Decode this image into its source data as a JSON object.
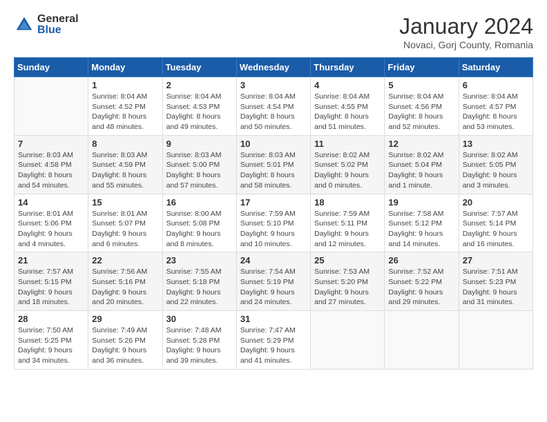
{
  "logo": {
    "general": "General",
    "blue": "Blue"
  },
  "header": {
    "title": "January 2024",
    "location": "Novaci, Gorj County, Romania"
  },
  "weekdays": [
    "Sunday",
    "Monday",
    "Tuesday",
    "Wednesday",
    "Thursday",
    "Friday",
    "Saturday"
  ],
  "weeks": [
    [
      {
        "day": "",
        "sunrise": "",
        "sunset": "",
        "daylight": ""
      },
      {
        "day": "1",
        "sunrise": "Sunrise: 8:04 AM",
        "sunset": "Sunset: 4:52 PM",
        "daylight": "Daylight: 8 hours and 48 minutes."
      },
      {
        "day": "2",
        "sunrise": "Sunrise: 8:04 AM",
        "sunset": "Sunset: 4:53 PM",
        "daylight": "Daylight: 8 hours and 49 minutes."
      },
      {
        "day": "3",
        "sunrise": "Sunrise: 8:04 AM",
        "sunset": "Sunset: 4:54 PM",
        "daylight": "Daylight: 8 hours and 50 minutes."
      },
      {
        "day": "4",
        "sunrise": "Sunrise: 8:04 AM",
        "sunset": "Sunset: 4:55 PM",
        "daylight": "Daylight: 8 hours and 51 minutes."
      },
      {
        "day": "5",
        "sunrise": "Sunrise: 8:04 AM",
        "sunset": "Sunset: 4:56 PM",
        "daylight": "Daylight: 8 hours and 52 minutes."
      },
      {
        "day": "6",
        "sunrise": "Sunrise: 8:04 AM",
        "sunset": "Sunset: 4:57 PM",
        "daylight": "Daylight: 8 hours and 53 minutes."
      }
    ],
    [
      {
        "day": "7",
        "sunrise": "Sunrise: 8:03 AM",
        "sunset": "Sunset: 4:58 PM",
        "daylight": "Daylight: 8 hours and 54 minutes."
      },
      {
        "day": "8",
        "sunrise": "Sunrise: 8:03 AM",
        "sunset": "Sunset: 4:59 PM",
        "daylight": "Daylight: 8 hours and 55 minutes."
      },
      {
        "day": "9",
        "sunrise": "Sunrise: 8:03 AM",
        "sunset": "Sunset: 5:00 PM",
        "daylight": "Daylight: 8 hours and 57 minutes."
      },
      {
        "day": "10",
        "sunrise": "Sunrise: 8:03 AM",
        "sunset": "Sunset: 5:01 PM",
        "daylight": "Daylight: 8 hours and 58 minutes."
      },
      {
        "day": "11",
        "sunrise": "Sunrise: 8:02 AM",
        "sunset": "Sunset: 5:02 PM",
        "daylight": "Daylight: 9 hours and 0 minutes."
      },
      {
        "day": "12",
        "sunrise": "Sunrise: 8:02 AM",
        "sunset": "Sunset: 5:04 PM",
        "daylight": "Daylight: 9 hours and 1 minute."
      },
      {
        "day": "13",
        "sunrise": "Sunrise: 8:02 AM",
        "sunset": "Sunset: 5:05 PM",
        "daylight": "Daylight: 9 hours and 3 minutes."
      }
    ],
    [
      {
        "day": "14",
        "sunrise": "Sunrise: 8:01 AM",
        "sunset": "Sunset: 5:06 PM",
        "daylight": "Daylight: 9 hours and 4 minutes."
      },
      {
        "day": "15",
        "sunrise": "Sunrise: 8:01 AM",
        "sunset": "Sunset: 5:07 PM",
        "daylight": "Daylight: 9 hours and 6 minutes."
      },
      {
        "day": "16",
        "sunrise": "Sunrise: 8:00 AM",
        "sunset": "Sunset: 5:08 PM",
        "daylight": "Daylight: 9 hours and 8 minutes."
      },
      {
        "day": "17",
        "sunrise": "Sunrise: 7:59 AM",
        "sunset": "Sunset: 5:10 PM",
        "daylight": "Daylight: 9 hours and 10 minutes."
      },
      {
        "day": "18",
        "sunrise": "Sunrise: 7:59 AM",
        "sunset": "Sunset: 5:11 PM",
        "daylight": "Daylight: 9 hours and 12 minutes."
      },
      {
        "day": "19",
        "sunrise": "Sunrise: 7:58 AM",
        "sunset": "Sunset: 5:12 PM",
        "daylight": "Daylight: 9 hours and 14 minutes."
      },
      {
        "day": "20",
        "sunrise": "Sunrise: 7:57 AM",
        "sunset": "Sunset: 5:14 PM",
        "daylight": "Daylight: 9 hours and 16 minutes."
      }
    ],
    [
      {
        "day": "21",
        "sunrise": "Sunrise: 7:57 AM",
        "sunset": "Sunset: 5:15 PM",
        "daylight": "Daylight: 9 hours and 18 minutes."
      },
      {
        "day": "22",
        "sunrise": "Sunrise: 7:56 AM",
        "sunset": "Sunset: 5:16 PM",
        "daylight": "Daylight: 9 hours and 20 minutes."
      },
      {
        "day": "23",
        "sunrise": "Sunrise: 7:55 AM",
        "sunset": "Sunset: 5:18 PM",
        "daylight": "Daylight: 9 hours and 22 minutes."
      },
      {
        "day": "24",
        "sunrise": "Sunrise: 7:54 AM",
        "sunset": "Sunset: 5:19 PM",
        "daylight": "Daylight: 9 hours and 24 minutes."
      },
      {
        "day": "25",
        "sunrise": "Sunrise: 7:53 AM",
        "sunset": "Sunset: 5:20 PM",
        "daylight": "Daylight: 9 hours and 27 minutes."
      },
      {
        "day": "26",
        "sunrise": "Sunrise: 7:52 AM",
        "sunset": "Sunset: 5:22 PM",
        "daylight": "Daylight: 9 hours and 29 minutes."
      },
      {
        "day": "27",
        "sunrise": "Sunrise: 7:51 AM",
        "sunset": "Sunset: 5:23 PM",
        "daylight": "Daylight: 9 hours and 31 minutes."
      }
    ],
    [
      {
        "day": "28",
        "sunrise": "Sunrise: 7:50 AM",
        "sunset": "Sunset: 5:25 PM",
        "daylight": "Daylight: 9 hours and 34 minutes."
      },
      {
        "day": "29",
        "sunrise": "Sunrise: 7:49 AM",
        "sunset": "Sunset: 5:26 PM",
        "daylight": "Daylight: 9 hours and 36 minutes."
      },
      {
        "day": "30",
        "sunrise": "Sunrise: 7:48 AM",
        "sunset": "Sunset: 5:28 PM",
        "daylight": "Daylight: 9 hours and 39 minutes."
      },
      {
        "day": "31",
        "sunrise": "Sunrise: 7:47 AM",
        "sunset": "Sunset: 5:29 PM",
        "daylight": "Daylight: 9 hours and 41 minutes."
      },
      {
        "day": "",
        "sunrise": "",
        "sunset": "",
        "daylight": ""
      },
      {
        "day": "",
        "sunrise": "",
        "sunset": "",
        "daylight": ""
      },
      {
        "day": "",
        "sunrise": "",
        "sunset": "",
        "daylight": ""
      }
    ]
  ]
}
